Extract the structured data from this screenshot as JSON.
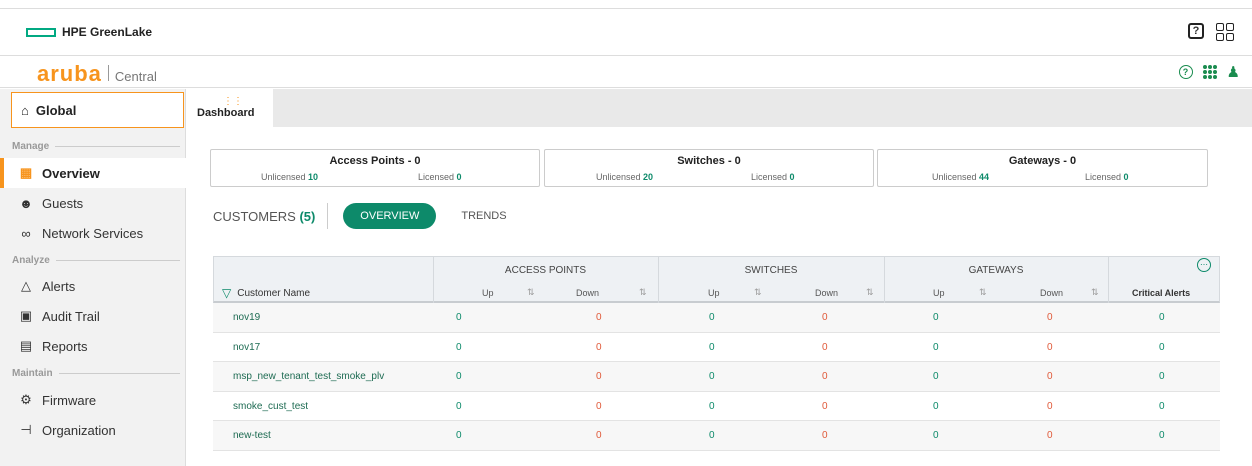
{
  "hpe": {
    "brand": "HPE GreenLake",
    "help_glyph": "?"
  },
  "aruba": {
    "logo": "aruba",
    "product": "Central"
  },
  "sidebar": {
    "global": "Global",
    "sections": {
      "manage": "Manage",
      "analyze": "Analyze",
      "maintain": "Maintain"
    },
    "items": [
      {
        "label": "Overview",
        "icon": "overview-grid-icon",
        "active": true
      },
      {
        "label": "Guests",
        "icon": "guests-icon"
      },
      {
        "label": "Network Services",
        "icon": "network-services-icon"
      },
      {
        "label": "Alerts",
        "icon": "bell-icon"
      },
      {
        "label": "Audit Trail",
        "icon": "audit-trail-icon"
      },
      {
        "label": "Reports",
        "icon": "reports-icon"
      },
      {
        "label": "Firmware",
        "icon": "firmware-icon"
      },
      {
        "label": "Organization",
        "icon": "organization-icon"
      }
    ]
  },
  "tab": {
    "label": "Dashboard"
  },
  "cards": [
    {
      "title": "Access Points - 0",
      "unlicensed_label": "Unlicensed",
      "unlicensed": "10",
      "licensed_label": "Licensed",
      "licensed": "0"
    },
    {
      "title": "Switches - 0",
      "unlicensed_label": "Unlicensed",
      "unlicensed": "20",
      "licensed_label": "Licensed",
      "licensed": "0"
    },
    {
      "title": "Gateways - 0",
      "unlicensed_label": "Unlicensed",
      "unlicensed": "44",
      "licensed_label": "Licensed",
      "licensed": "0"
    }
  ],
  "filters": {
    "customers": "CUSTOMERS",
    "customers_count": "(5)",
    "overview": "OVERVIEW",
    "trends": "TRENDS"
  },
  "table": {
    "groups": [
      "ACCESS POINTS",
      "SWITCHES",
      "GATEWAYS"
    ],
    "name_header": "Customer Name",
    "up": "Up",
    "down": "Down",
    "critical": "Critical Alerts",
    "rows": [
      {
        "name": "nov19",
        "ap_up": "0",
        "ap_down": "0",
        "sw_up": "0",
        "sw_down": "0",
        "gw_up": "0",
        "gw_down": "0",
        "crit": "0"
      },
      {
        "name": "nov17",
        "ap_up": "0",
        "ap_down": "0",
        "sw_up": "0",
        "sw_down": "0",
        "gw_up": "0",
        "gw_down": "0",
        "crit": "0"
      },
      {
        "name": "msp_new_tenant_test_smoke_plv",
        "ap_up": "0",
        "ap_down": "0",
        "sw_up": "0",
        "sw_down": "0",
        "gw_up": "0",
        "gw_down": "0",
        "crit": "0"
      },
      {
        "name": "smoke_cust_test",
        "ap_up": "0",
        "ap_down": "0",
        "sw_up": "0",
        "sw_down": "0",
        "gw_up": "0",
        "gw_down": "0",
        "crit": "0"
      },
      {
        "name": "new-test",
        "ap_up": "0",
        "ap_down": "0",
        "sw_up": "0",
        "sw_down": "0",
        "gw_up": "0",
        "gw_down": "0",
        "crit": "0"
      }
    ]
  },
  "colors": {
    "accent": "#f7941d",
    "teal": "#0d8a6a",
    "down_red": "#e05a3a",
    "hpe_green": "#01a982"
  }
}
